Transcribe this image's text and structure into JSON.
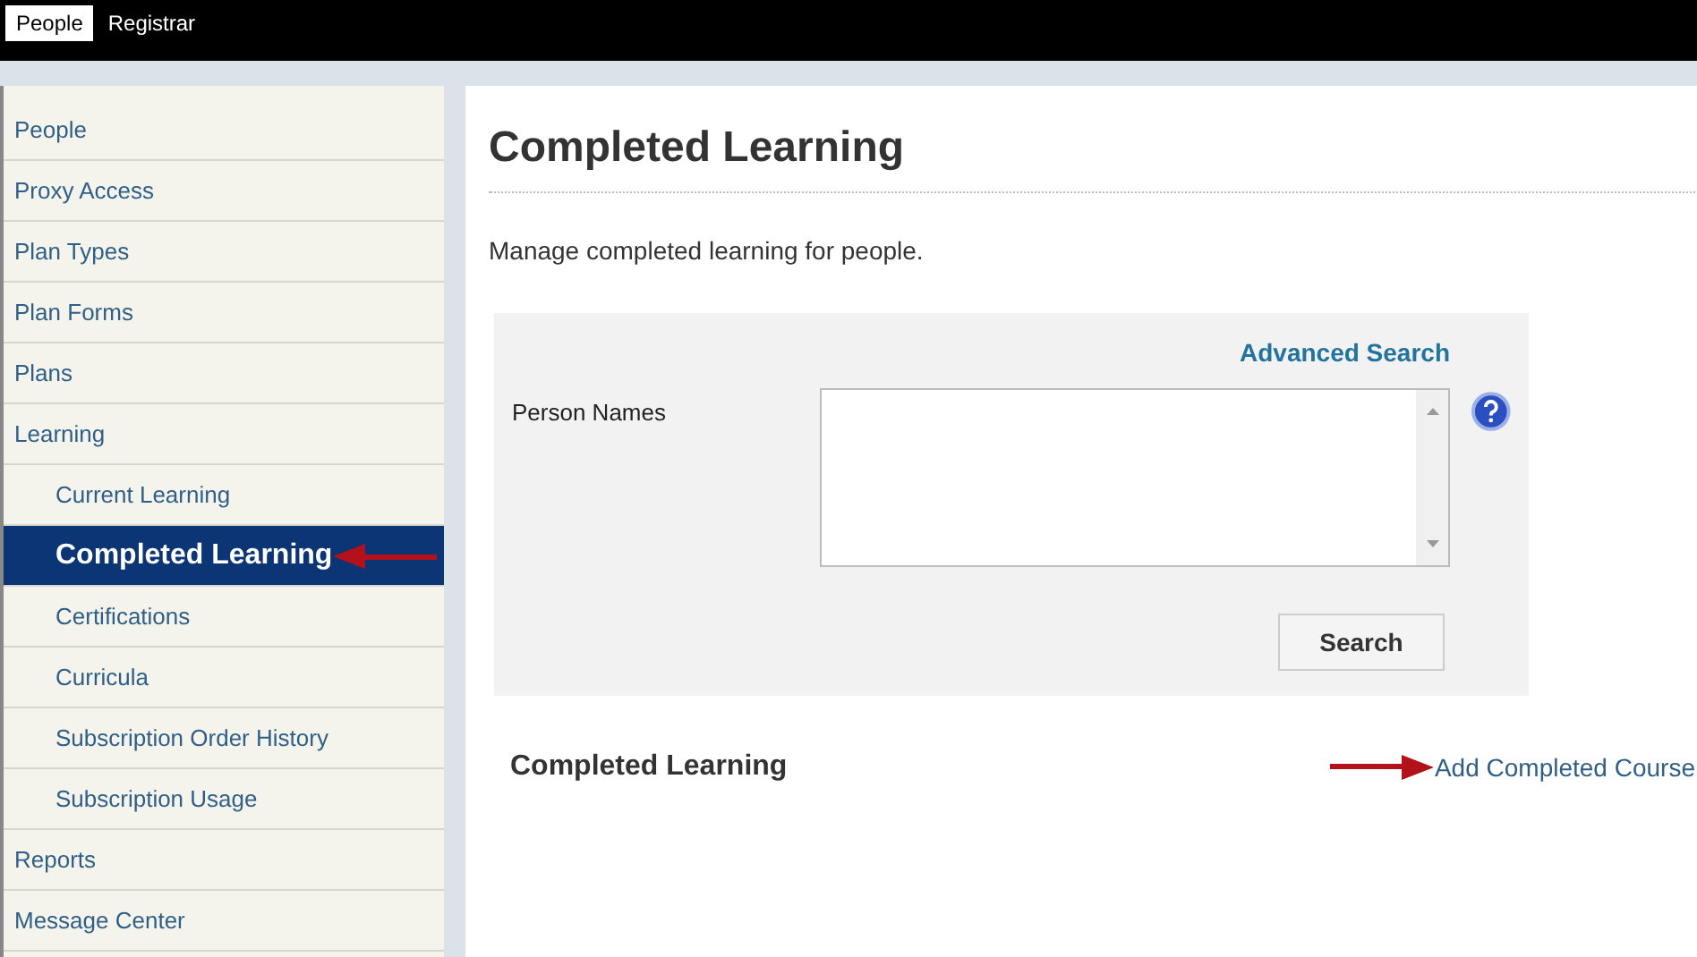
{
  "top_tabs": [
    {
      "label": "People",
      "selected": true
    },
    {
      "label": "Registrar",
      "selected": false
    }
  ],
  "sidebar": {
    "items": [
      {
        "label": "People",
        "selected": false
      },
      {
        "label": "Proxy Access",
        "selected": false
      },
      {
        "label": "Plan Types",
        "selected": false
      },
      {
        "label": "Plan Forms",
        "selected": false
      },
      {
        "label": "Plans",
        "selected": false
      },
      {
        "label": "Learning",
        "selected": false,
        "children": [
          {
            "label": "Current Learning",
            "selected": false
          },
          {
            "label": "Completed Learning",
            "selected": true
          },
          {
            "label": "Certifications",
            "selected": false
          },
          {
            "label": "Curricula",
            "selected": false
          },
          {
            "label": "Subscription Order History",
            "selected": false
          },
          {
            "label": "Subscription Usage",
            "selected": false
          }
        ]
      },
      {
        "label": "Reports",
        "selected": false
      },
      {
        "label": "Message Center",
        "selected": false
      }
    ]
  },
  "page": {
    "title": "Completed Learning",
    "description": "Manage completed learning for people.",
    "search_panel": {
      "advanced_link": "Advanced Search",
      "field_label": "Person Names",
      "button": "Search"
    },
    "section_title": "Completed Learning",
    "add_link": "Add Completed Course"
  }
}
